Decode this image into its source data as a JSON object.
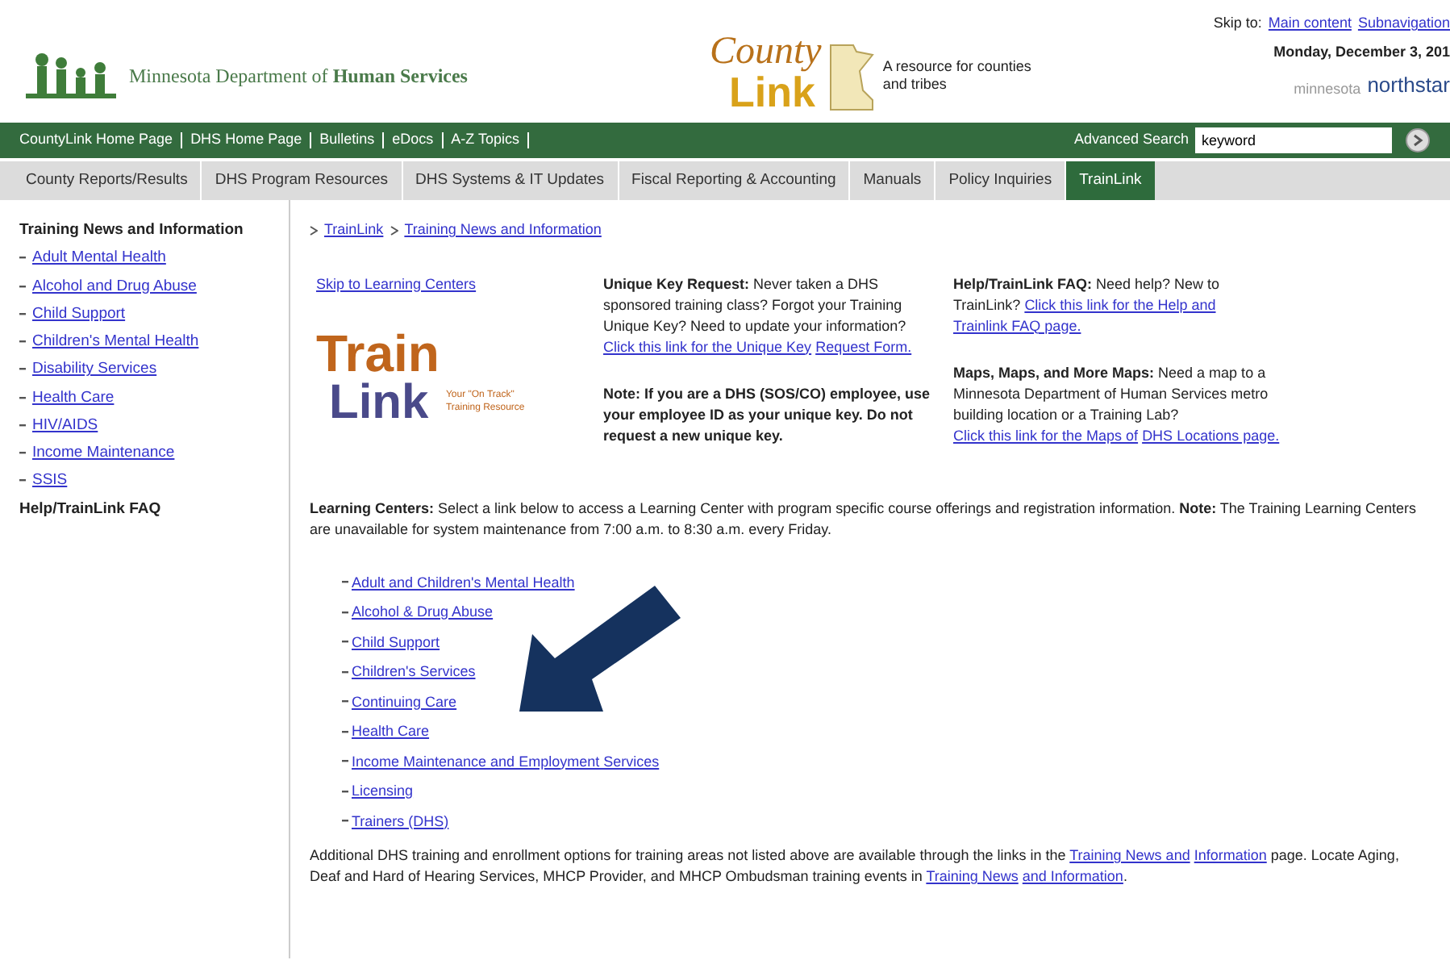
{
  "header": {
    "agency": "Minnesota Department of **Human Services**",
    "county_logo": {
      "word1": "County",
      "word2": "Link",
      "tagline": "A resource for counties and tribes"
    },
    "skip_label": "Skip to:",
    "skip_links": [
      "Main content",
      "Subnavigation"
    ],
    "date": "Monday, December 3, 201",
    "northstar": {
      "word1": "minnesota",
      "word2": "northstar"
    }
  },
  "top_links": [
    "CountyLink Home Page",
    "DHS Home Page",
    "Bulletins",
    "eDocs",
    "A-Z Topics"
  ],
  "search": {
    "label": "Advanced Search",
    "value": "keyword"
  },
  "tabs": [
    {
      "label": "County Reports/Results",
      "selected": false
    },
    {
      "label": "DHS Program Resources",
      "selected": false
    },
    {
      "label": "DHS Systems & IT Updates",
      "selected": false
    },
    {
      "label": "Fiscal Reporting & Accounting",
      "selected": false
    },
    {
      "label": "Manuals",
      "selected": false
    },
    {
      "label": "Policy Inquiries",
      "selected": false
    },
    {
      "label": "TrainLink",
      "selected": true
    }
  ],
  "sidebar": {
    "heading": "Training News and Information",
    "items": [
      "Adult Mental Health",
      "Alcohol and Drug Abuse",
      "Child Support",
      "Children's Mental Health",
      "Disability Services",
      "Health Care",
      "HIV/AIDS",
      "Income Maintenance",
      "SSIS"
    ],
    "footer": "Help/TrainLink FAQ"
  },
  "breadcrumb": [
    "TrainLink",
    "Training News and Information"
  ],
  "skip_learning": "Skip to Learning Centers",
  "trainlink_logo": {
    "word1": "Train",
    "word2": "Link",
    "tagline": "Your \"On Track\" Training Resource"
  },
  "info_columns": [
    [
      {
        "parts": [
          {
            "kind": "bold",
            "text": "Unique Key Request:"
          },
          {
            "kind": "text",
            "text": " Never taken a DHS sponsored training class? Forgot your Training Unique Key? Need to update your information? "
          },
          {
            "kind": "link",
            "text": "Click this link for the Unique Key"
          },
          {
            "kind": "link",
            "text": "Request Form."
          }
        ]
      },
      {
        "parts": [
          {
            "kind": "bold",
            "text": "Note: If you are a DHS (SOS/CO) employee, use your employee ID as your unique key. Do not request a new unique key."
          }
        ]
      }
    ],
    [
      {
        "parts": [
          {
            "kind": "bold",
            "text": "Help/TrainLink FAQ:"
          },
          {
            "kind": "text",
            "text": " Need help? New to TrainLink? "
          },
          {
            "kind": "link",
            "text": "Click this link for the Help and"
          },
          {
            "kind": "link",
            "text": "Trainlink FAQ page."
          }
        ]
      },
      {
        "parts": [
          {
            "kind": "bold",
            "text": "Maps, Maps, and More Maps:"
          },
          {
            "kind": "text",
            "text": " Need a map to a Minnesota Department of Human Services metro building location or a Training Lab? "
          },
          {
            "kind": "link",
            "text": "Click this link for the Maps of"
          },
          {
            "kind": "link",
            "text": "DHS Locations page."
          }
        ]
      }
    ]
  ],
  "learning_intro": {
    "parts": [
      {
        "kind": "bold",
        "text": "Learning Centers:"
      },
      {
        "kind": "text",
        "text": " Select a link below to access a Learning Center with program specific course offerings and registration information. "
      },
      {
        "kind": "bold",
        "text": "Note:"
      },
      {
        "kind": "text",
        "text": " The Training Learning Centers are unavailable for system maintenance from 7:00 a.m. to 8:30 a.m. every Friday."
      }
    ]
  },
  "learning_centers": [
    "Adult and Children's Mental Health",
    "Alcohol & Drug Abuse",
    "Child Support",
    "Children's Services",
    "Continuing Care",
    "Health Care",
    "Income Maintenance and Employment Services",
    "Licensing",
    "Trainers (DHS)"
  ],
  "additional": {
    "parts": [
      {
        "kind": "text",
        "text": "Additional DHS training and enrollment options for training areas not listed above are available through the links in the "
      },
      {
        "kind": "link",
        "text": "Training News and"
      },
      {
        "kind": "link",
        "text": "Information"
      },
      {
        "kind": "text",
        "text": " page. Locate Aging, Deaf and Hard of Hearing Services, MHCP Provider, and MHCP Ombudsman training events in "
      },
      {
        "kind": "link",
        "text": "Training News"
      },
      {
        "kind": "link",
        "text": "and Information"
      },
      {
        "kind": "text",
        "text": "."
      }
    ]
  }
}
